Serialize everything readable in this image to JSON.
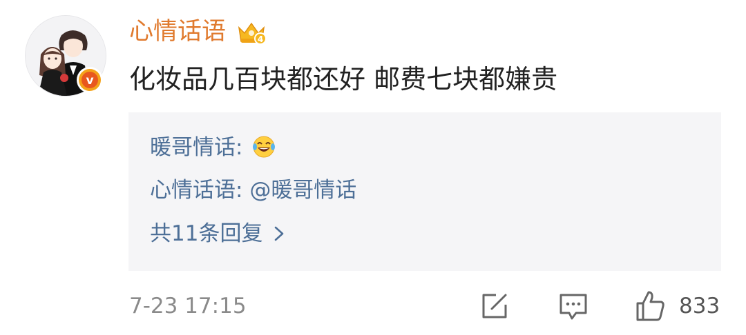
{
  "comment": {
    "username": "心情话语",
    "text": "化妆品几百块都还好 邮费七块都嫌贵",
    "timestamp": "7-23 17:15",
    "like_count": "833",
    "badge_icon": "crown-badge-icon",
    "badge_level": "4",
    "verified_letter": "v"
  },
  "replies": {
    "items": [
      {
        "author": "暖哥情话",
        "sep": ": ",
        "text": "",
        "emoji": "laughing-tears-emoji"
      },
      {
        "author": "心情话语",
        "sep": ": ",
        "text": "@暖哥情话"
      }
    ],
    "more_label": "共11条回复"
  },
  "colors": {
    "username": "#e07a2e",
    "link": "#4d6f97",
    "reply_bg": "#f5f5f7",
    "muted": "#8a8a8a"
  },
  "icons": {
    "share": "edit-share-icon",
    "comment": "comment-bubble-icon",
    "like": "thumbs-up-icon"
  }
}
